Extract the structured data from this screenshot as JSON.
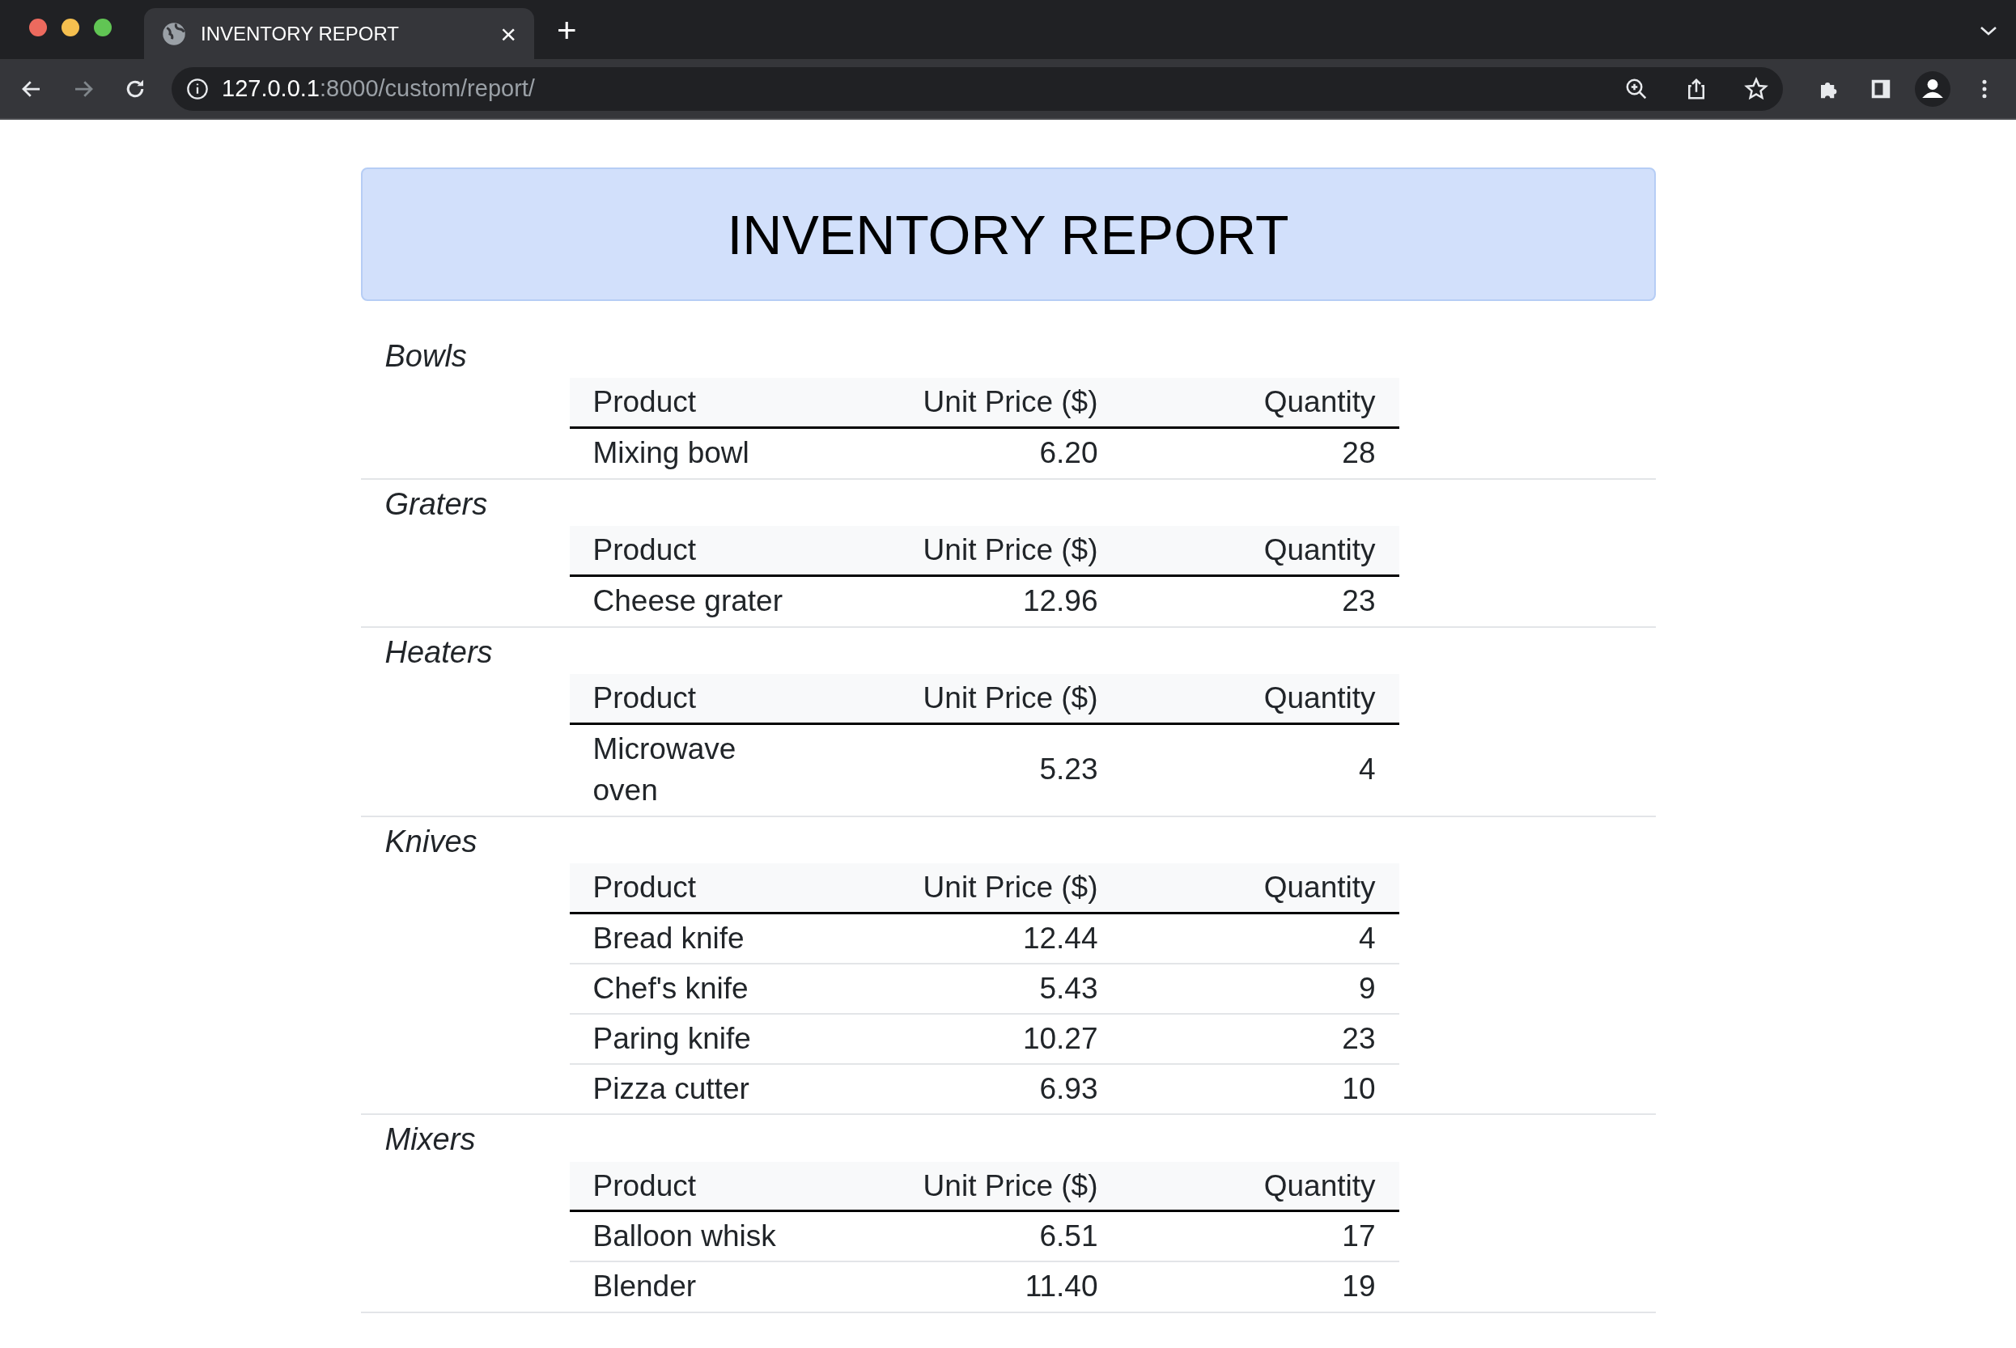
{
  "browser": {
    "tab_title": "INVENTORY REPORT",
    "tab_close": "×",
    "new_tab": "+",
    "url_host": "127.0.0.1",
    "url_path": ":8000/custom/report/"
  },
  "report": {
    "title": "INVENTORY REPORT",
    "sections": [
      {
        "name": "Bowls",
        "columns": [
          "Product",
          "Unit Price ($)",
          "Quantity"
        ],
        "rows": [
          [
            "Mixing bowl",
            "6.20",
            "28"
          ]
        ]
      },
      {
        "name": "Graters",
        "columns": [
          "Product",
          "Unit Price ($)",
          "Quantity"
        ],
        "rows": [
          [
            "Cheese grater",
            "12.96",
            "23"
          ]
        ]
      },
      {
        "name": "Heaters",
        "columns": [
          "Product",
          "Unit Price ($)",
          "Quantity"
        ],
        "rows": [
          [
            "Microwave oven",
            "5.23",
            "4"
          ]
        ]
      },
      {
        "name": "Knives",
        "columns": [
          "Product",
          "Unit Price ($)",
          "Quantity"
        ],
        "rows": [
          [
            "Bread knife",
            "12.44",
            "4"
          ],
          [
            "Chef's knife",
            "5.43",
            "9"
          ],
          [
            "Paring knife",
            "10.27",
            "23"
          ],
          [
            "Pizza cutter",
            "6.93",
            "10"
          ]
        ]
      },
      {
        "name": "Mixers",
        "columns": [
          "Product",
          "Unit Price ($)",
          "Quantity"
        ],
        "rows": [
          [
            "Balloon whisk",
            "6.51",
            "17"
          ],
          [
            "Blender",
            "11.40",
            "19"
          ]
        ]
      }
    ]
  }
}
